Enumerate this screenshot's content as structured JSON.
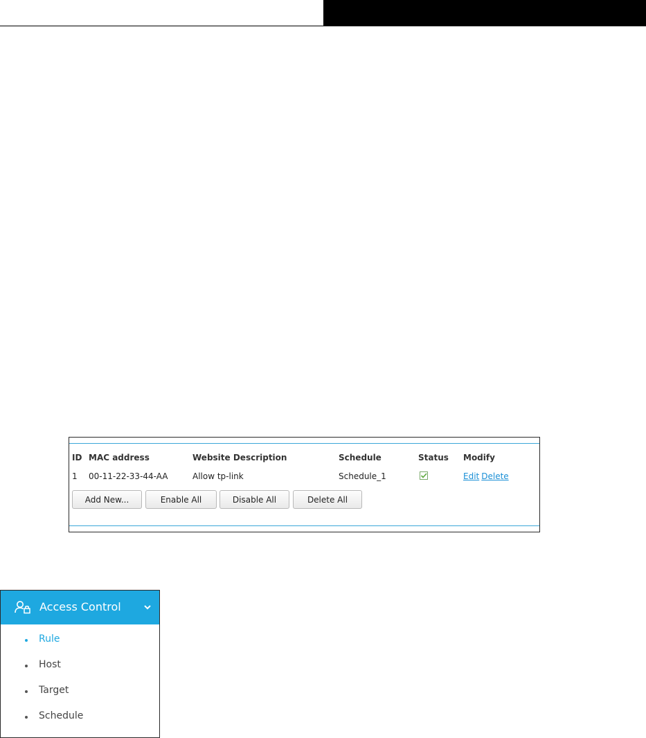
{
  "rule_table": {
    "columns": {
      "id": "ID",
      "mac": "MAC address",
      "description": "Website Description",
      "schedule": "Schedule",
      "status": "Status",
      "modify": "Modify"
    },
    "rows": [
      {
        "id": "1",
        "mac": "00-11-22-33-44-AA",
        "description": "Allow tp-link",
        "schedule": "Schedule_1",
        "status_enabled": true,
        "edit_label": "Edit",
        "delete_label": "Delete"
      }
    ],
    "buttons": {
      "add_new": "Add New...",
      "enable_all": "Enable All",
      "disable_all": "Disable All",
      "delete_all": "Delete All"
    }
  },
  "menu": {
    "title": "Access Control",
    "icon": "user-lock-icon",
    "items": [
      {
        "label": "Rule",
        "active": true
      },
      {
        "label": "Host",
        "active": false
      },
      {
        "label": "Target",
        "active": false
      },
      {
        "label": "Schedule",
        "active": false
      }
    ]
  },
  "colors": {
    "accent": "#1ea8e0",
    "link": "#1a8fd6",
    "status_check": "#5aa83a"
  }
}
